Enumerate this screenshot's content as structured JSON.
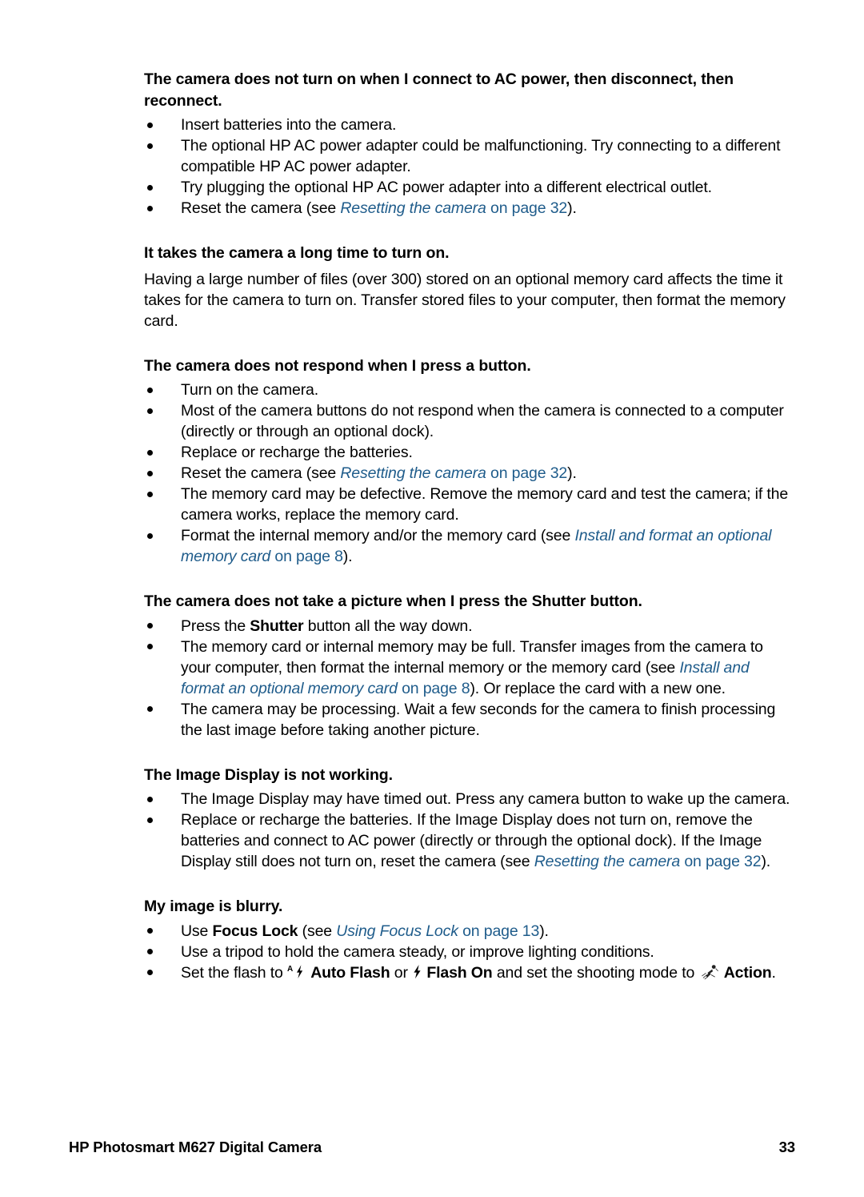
{
  "document": {
    "footer": {
      "left": "HP Photosmart M627 Digital Camera",
      "page_number": "33"
    },
    "link_color": "#1F5C8B",
    "text_color": "#000000",
    "background": "#FFFFFF"
  },
  "sections": [
    {
      "heading": "The camera does not turn on when I connect to AC power, then disconnect, then reconnect.",
      "bullets": [
        {
          "parts": [
            {
              "t": "Insert batteries into the camera.",
              "s": "plain"
            }
          ]
        },
        {
          "parts": [
            {
              "t": "The optional HP AC power adapter could be malfunctioning. Try connecting to a different compatible HP AC power adapter.",
              "s": "plain"
            }
          ]
        },
        {
          "parts": [
            {
              "t": "Try plugging the optional HP AC power adapter into a different electrical outlet.",
              "s": "plain"
            }
          ]
        },
        {
          "parts": [
            {
              "t": "Reset the camera (see ",
              "s": "plain"
            },
            {
              "t": "Resetting the camera",
              "s": "link-italic"
            },
            {
              "t": " on page 32",
              "s": "link"
            },
            {
              "t": ").",
              "s": "plain"
            }
          ]
        }
      ]
    },
    {
      "heading": "It takes the camera a long time to turn on.",
      "paragraph": "Having a large number of files (over 300) stored on an optional memory card affects the time it takes for the camera to turn on. Transfer stored files to your computer, then format the memory card."
    },
    {
      "heading": "The camera does not respond when I press a button.",
      "bullets": [
        {
          "parts": [
            {
              "t": "Turn on the camera.",
              "s": "plain"
            }
          ]
        },
        {
          "parts": [
            {
              "t": "Most of the camera buttons do not respond when the camera is connected to a computer (directly or through an optional dock).",
              "s": "plain"
            }
          ]
        },
        {
          "parts": [
            {
              "t": "Replace or recharge the batteries.",
              "s": "plain"
            }
          ]
        },
        {
          "parts": [
            {
              "t": "Reset the camera (see ",
              "s": "plain"
            },
            {
              "t": "Resetting the camera",
              "s": "link-italic"
            },
            {
              "t": " on page 32",
              "s": "link"
            },
            {
              "t": ").",
              "s": "plain"
            }
          ]
        },
        {
          "parts": [
            {
              "t": "The memory card may be defective. Remove the memory card and test the camera; if the camera works, replace the memory card.",
              "s": "plain"
            }
          ]
        },
        {
          "parts": [
            {
              "t": "Format the internal memory and/or the memory card (see ",
              "s": "plain"
            },
            {
              "t": "Install and format an optional memory card",
              "s": "link-italic"
            },
            {
              "t": " on page 8",
              "s": "link"
            },
            {
              "t": ").",
              "s": "plain"
            }
          ]
        }
      ]
    },
    {
      "heading": "The camera does not take a picture when I press the Shutter button.",
      "bullets": [
        {
          "parts": [
            {
              "t": "Press the ",
              "s": "plain"
            },
            {
              "t": "Shutter",
              "s": "bold"
            },
            {
              "t": " button all the way down.",
              "s": "plain"
            }
          ]
        },
        {
          "parts": [
            {
              "t": "The memory card or internal memory may be full. Transfer images from the camera to your computer, then format the internal memory or the memory card (see ",
              "s": "plain"
            },
            {
              "t": "Install and format an optional memory card",
              "s": "link-italic"
            },
            {
              "t": " on page 8",
              "s": "link"
            },
            {
              "t": "). Or replace the card with a new one.",
              "s": "plain"
            }
          ]
        },
        {
          "parts": [
            {
              "t": "The camera may be processing. Wait a few seconds for the camera to finish processing the last image before taking another picture.",
              "s": "plain"
            }
          ]
        }
      ]
    },
    {
      "heading": "The Image Display is not working.",
      "bullets": [
        {
          "parts": [
            {
              "t": "The Image Display may have timed out. Press any camera button to wake up the camera.",
              "s": "plain"
            }
          ]
        },
        {
          "parts": [
            {
              "t": "Replace or recharge the batteries. If the Image Display does not turn on, remove the batteries and connect to AC power (directly or through the optional dock). If the Image Display still does not turn on, reset the camera (see ",
              "s": "plain"
            },
            {
              "t": "Resetting the camera",
              "s": "link-italic"
            },
            {
              "t": " on page 32",
              "s": "link"
            },
            {
              "t": ").",
              "s": "plain"
            }
          ]
        }
      ]
    },
    {
      "heading": "My image is blurry.",
      "bullets": [
        {
          "parts": [
            {
              "t": "Use ",
              "s": "plain"
            },
            {
              "t": "Focus Lock",
              "s": "bold"
            },
            {
              "t": " (see ",
              "s": "plain"
            },
            {
              "t": "Using Focus Lock",
              "s": "link-italic"
            },
            {
              "t": " on page 13",
              "s": "link"
            },
            {
              "t": ").",
              "s": "plain"
            }
          ]
        },
        {
          "parts": [
            {
              "t": "Use a tripod to hold the camera steady, or improve lighting conditions.",
              "s": "plain"
            }
          ]
        },
        {
          "parts": [
            {
              "t": "Set the flash to ",
              "s": "plain"
            },
            {
              "t": "auto-flash-icon",
              "s": "icon"
            },
            {
              "t": "Auto Flash",
              "s": "bold"
            },
            {
              "t": " or ",
              "s": "plain"
            },
            {
              "t": "flash-on-icon",
              "s": "icon"
            },
            {
              "t": "Flash On",
              "s": "bold"
            },
            {
              "t": " and set the shooting mode to ",
              "s": "plain"
            },
            {
              "t": "action-mode-icon",
              "s": "icon"
            },
            {
              "t": "Action",
              "s": "bold"
            },
            {
              "t": ".",
              "s": "plain"
            }
          ]
        }
      ]
    }
  ],
  "icons": {
    "auto_flash": "auto-flash-icon",
    "flash_on": "flash-on-icon",
    "action_mode": "action-mode-icon"
  }
}
